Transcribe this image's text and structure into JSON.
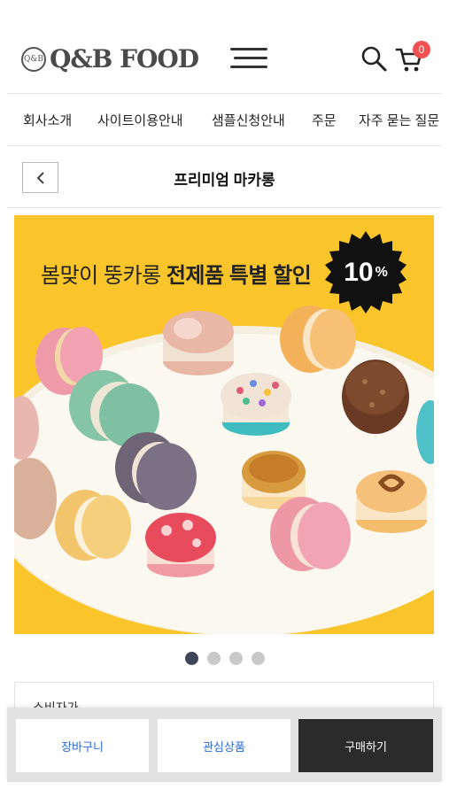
{
  "header": {
    "logo_emblem": "Q&B",
    "logo_text": "Q&B FOOD",
    "cart_count": "0"
  },
  "nav": {
    "items": [
      "회사소개",
      "사이트이용안내",
      "샘플신청안내",
      "주문",
      "자주 묻는 질문"
    ]
  },
  "page": {
    "title": "프리미엄 마카롱"
  },
  "banner": {
    "headline_regular": "봄맞이 뚱카롱 ",
    "headline_bold": "전제품 특별 할인",
    "discount_value": "10",
    "discount_unit": "%",
    "background_color": "#f9c52b"
  },
  "carousel": {
    "total": 4,
    "active_index": 0
  },
  "price": {
    "consumer_price_label": "소비자가"
  },
  "actions": {
    "cart_label": "장바구니",
    "wishlist_label": "관심상품",
    "buy_label": "구매하기"
  },
  "icons": {
    "menu": "hamburger-menu-icon",
    "search": "search-icon",
    "cart": "cart-icon",
    "back": "chevron-left-icon"
  }
}
